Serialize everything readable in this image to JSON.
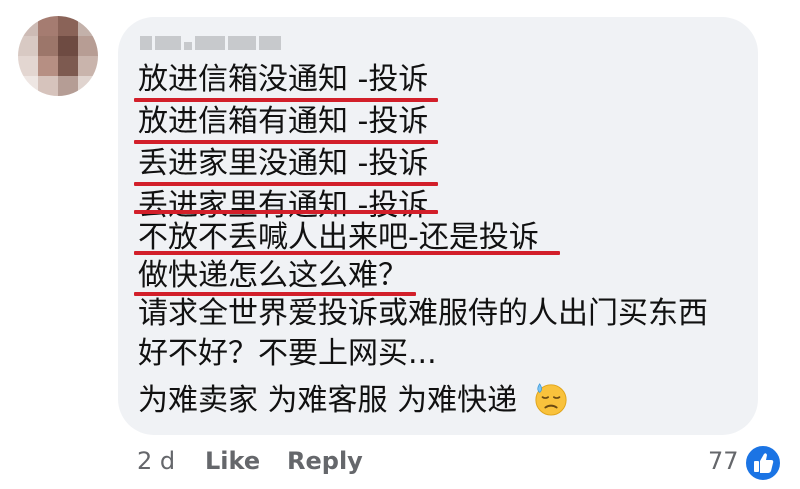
{
  "comment": {
    "lines": [
      "放进信箱没通知 -投诉",
      "放进信箱有通知 -投诉",
      "丢进家里没通知 -投诉",
      "丢进家里有通知 -投诉",
      "不放不丢喊人出来吧-还是投诉",
      "做快递怎么这么难？",
      "请求全世界爱投诉或难服侍的人出门买东西",
      "好不好？不要上网买...",
      "为难卖家 为难客服 为难快递"
    ],
    "emoji": "sad-sweat-face-emoji"
  },
  "footer": {
    "timestamp": "2 d",
    "like_label": "Like",
    "reply_label": "Reply",
    "like_count": "77"
  },
  "colors": {
    "bubble": "#f0f2f5",
    "underline": "#d21f2a",
    "link_gray": "#65676b",
    "like_blue": "#1b74e4"
  }
}
